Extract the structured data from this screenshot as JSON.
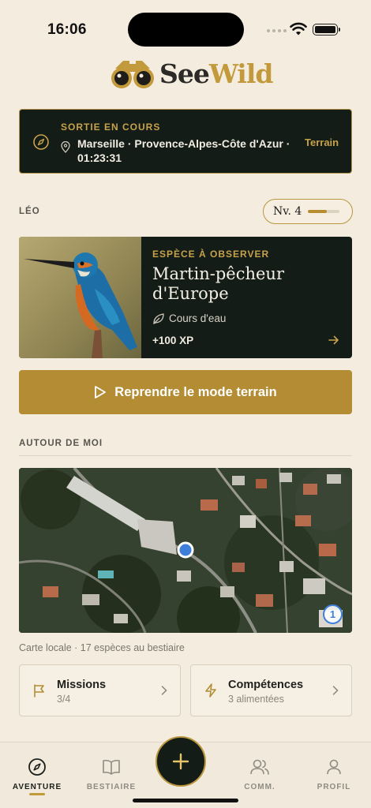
{
  "status": {
    "time": "16:06"
  },
  "brand": {
    "see": "See",
    "wild": "Wild"
  },
  "outing": {
    "label": "SORTIE EN COURS",
    "location": "Marseille · Provence-Alpes-Côte d'Azur · 01:23:31",
    "mode": "Terrain"
  },
  "user": {
    "name": "LÉO",
    "level": "Nv. 4",
    "level_progress": 0.6
  },
  "species": {
    "eyebrow": "ESPÈCE À OBSERVER",
    "name": "Martin-pêcheur d'Europe",
    "habitat": "Cours d'eau",
    "xp": "+100 XP"
  },
  "resume_button": {
    "label": "Reprendre le mode terrain"
  },
  "around": {
    "title": "AUTOUR DE MOI",
    "caption": "Carte locale · 17 espèces au bestiaire",
    "badge": "1"
  },
  "cards": {
    "missions": {
      "title": "Missions",
      "sub": "3/4"
    },
    "skills": {
      "title": "Compétences",
      "sub": "3 alimentées"
    }
  },
  "nav": {
    "adventure": "AVENTURE",
    "bestiary": "BESTIAIRE",
    "community": "COMM.",
    "profile": "PROFIL"
  },
  "colors": {
    "gold": "#c29a3b",
    "dark": "#141c17",
    "background": "#f3ecdf"
  }
}
